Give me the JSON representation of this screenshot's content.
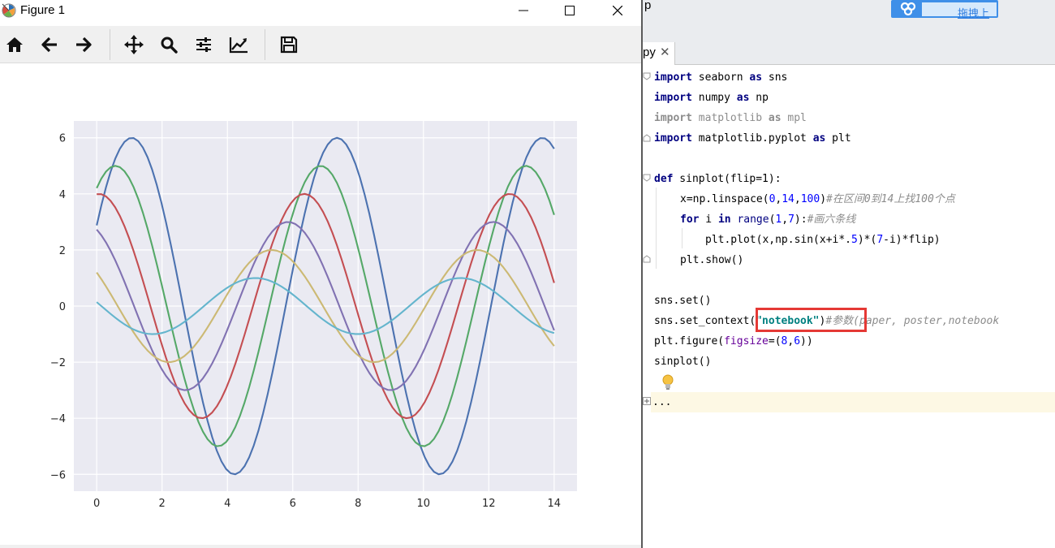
{
  "figure_window": {
    "title": "Figure 1",
    "toolbar": {
      "home_icon": "home-icon",
      "back_icon": "arrow-left-icon",
      "forward_icon": "arrow-right-icon",
      "pan_icon": "move-icon",
      "zoom_icon": "search-icon",
      "subplots_icon": "sliders-icon",
      "customize_icon": "chart-line-icon",
      "save_icon": "save-icon"
    }
  },
  "chart_data": {
    "type": "line",
    "title": "",
    "xlabel": "",
    "ylabel": "",
    "xlim": [
      -0.7,
      14.7
    ],
    "ylim": [
      -6.6,
      6.6
    ],
    "xticks": [
      0,
      2,
      4,
      6,
      8,
      10,
      12,
      14
    ],
    "yticks": [
      -6,
      -4,
      -2,
      0,
      2,
      4,
      6
    ],
    "xtick_labels": [
      "0",
      "2",
      "4",
      "6",
      "8",
      "10",
      "12",
      "14"
    ],
    "ytick_labels": [
      "−6",
      "−4",
      "−2",
      "0",
      "2",
      "4",
      "6"
    ],
    "grid": true,
    "background": "#eaeaf2",
    "series": [
      {
        "amplitude": 6,
        "phase": 0.5,
        "color": "#4c72b0"
      },
      {
        "amplitude": 5,
        "phase": 1.0,
        "color": "#55a868"
      },
      {
        "amplitude": 4,
        "phase": 1.5,
        "color": "#c44e52"
      },
      {
        "amplitude": 3,
        "phase": 2.0,
        "color": "#8172b2"
      },
      {
        "amplitude": 2,
        "phase": 2.5,
        "color": "#ccb974"
      },
      {
        "amplitude": 1,
        "phase": 3.0,
        "color": "#64b5cd"
      }
    ],
    "x_range": [
      0,
      14
    ],
    "samples": 100,
    "formula": "y = sin(x + phase) * amplitude"
  },
  "editor": {
    "top_text": "p",
    "cloud_widget_text": "拖拽上",
    "tab_label": "py",
    "tab_close": "✕",
    "code_lines": [
      {
        "a": "import",
        "b": " seaborn ",
        "c": "as",
        "d": " sns"
      },
      {
        "a": "import",
        "b": " numpy ",
        "c": "as",
        "d": " np"
      },
      {
        "a": "import",
        "b": " matplotlib ",
        "c": "as",
        "d": " mpl"
      },
      {
        "a": "import",
        "b": " matplotlib.pyplot ",
        "c": "as",
        "d": " plt"
      }
    ],
    "def_line": {
      "kw": "def",
      "rest": " sinplot(flip=1):"
    },
    "linspace_line": {
      "pre": "x=np.linspace(",
      "n0": "0",
      "c1": ",",
      "n1": "14",
      "c2": ",",
      "n2": "100",
      "post": ")",
      "comment": "#在区间0到14上找100个点"
    },
    "for_line": {
      "kw_for": "for",
      "var": " i ",
      "kw_in": "in",
      "sp": " ",
      "bi": "range",
      "p1": "(",
      "n1": "1",
      "c": ",",
      "n2": "7",
      "p2": "):",
      "comment": "#画六条线"
    },
    "plot_line": {
      "pre": "plt.plot(x,np.sin(x+i*.",
      "n1": "5",
      "mid": ")*(",
      "n2": "7",
      "post": "-i)*flip)"
    },
    "show_line": "plt.show()",
    "set_line": "sns.set()",
    "context_line": {
      "pre": "sns.set_context(",
      "str": "\"notebook\"",
      "post": ")",
      "comment": "#参数(paper, poster,notebook"
    },
    "figure_line": {
      "pre": "plt.figure(",
      "kwarg": "figsize",
      "eq": "=(",
      "n1": "8",
      "c": ",",
      "n2": "6",
      "post": "))"
    },
    "call_line": "sinplot()",
    "ellipsis": "..."
  }
}
